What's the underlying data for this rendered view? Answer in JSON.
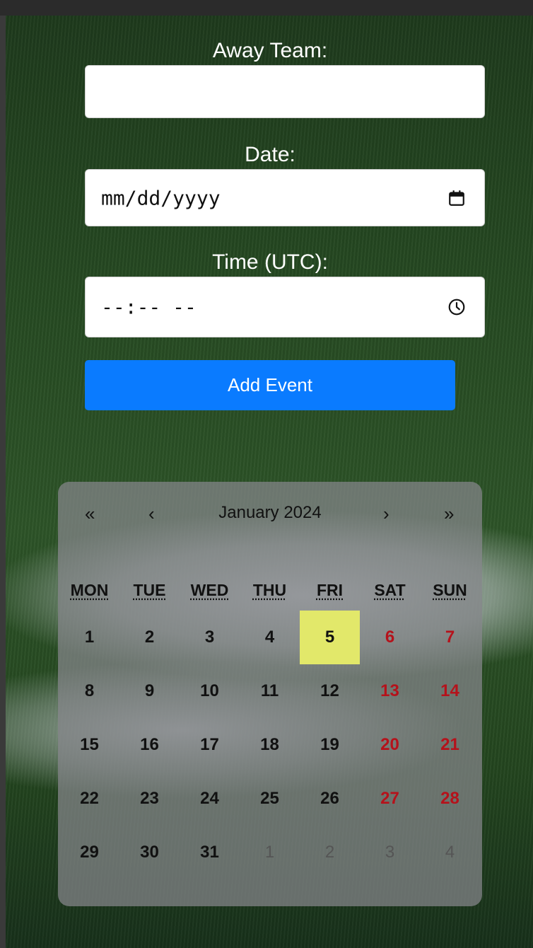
{
  "form": {
    "away_team_label": "Away Team:",
    "away_team_value": "",
    "date_label": "Date:",
    "date_placeholder": "mm/dd/yyyy",
    "time_label": "Time (UTC):",
    "time_placeholder": "--:-- --",
    "add_button": "Add Event"
  },
  "calendar": {
    "prev_year": "«",
    "prev_month": "‹",
    "title": "January 2024",
    "next_month": "›",
    "next_year": "»",
    "weekdays": [
      "MON",
      "TUE",
      "WED",
      "THU",
      "FRI",
      "SAT",
      "SUN"
    ],
    "days": [
      [
        "1",
        "2",
        "3",
        "4",
        "5",
        "6",
        "7"
      ],
      [
        "8",
        "9",
        "10",
        "11",
        "12",
        "13",
        "14"
      ],
      [
        "15",
        "16",
        "17",
        "18",
        "19",
        "20",
        "21"
      ],
      [
        "22",
        "23",
        "24",
        "25",
        "26",
        "27",
        "28"
      ],
      [
        "29",
        "30",
        "31",
        "1",
        "2",
        "3",
        "4"
      ]
    ],
    "highlighted_day": "5",
    "colors": {
      "weekend": "#b5121b",
      "highlight": "#e2e86a",
      "button": "#0a7bff"
    }
  }
}
